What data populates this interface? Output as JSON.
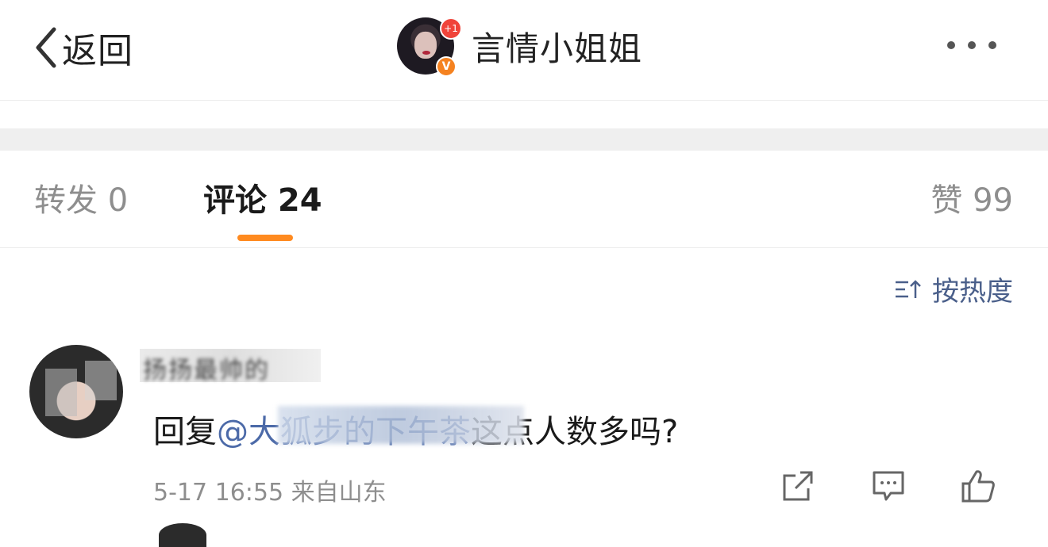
{
  "header": {
    "back_label": "返回",
    "profile_name": "言情小姐姐",
    "plus_badge": "+1",
    "verified_badge": "V"
  },
  "tabs": {
    "repost": "转发 0",
    "comment": "评论 24",
    "like": "赞 99"
  },
  "sort": {
    "label": "按热度"
  },
  "comment": {
    "username": "扬扬最帅的",
    "reply_prefix": "回复",
    "mention": "@大狐步的下午茶",
    "text": "这点人数多吗?",
    "meta": "5-17 16:55 来自山东"
  },
  "colors": {
    "accent_underline": "#ff8a1f",
    "mention": "#4c6aa8",
    "sort_text": "#4a5f8a",
    "badge_red": "#f0443a",
    "badge_orange": "#f58220"
  }
}
